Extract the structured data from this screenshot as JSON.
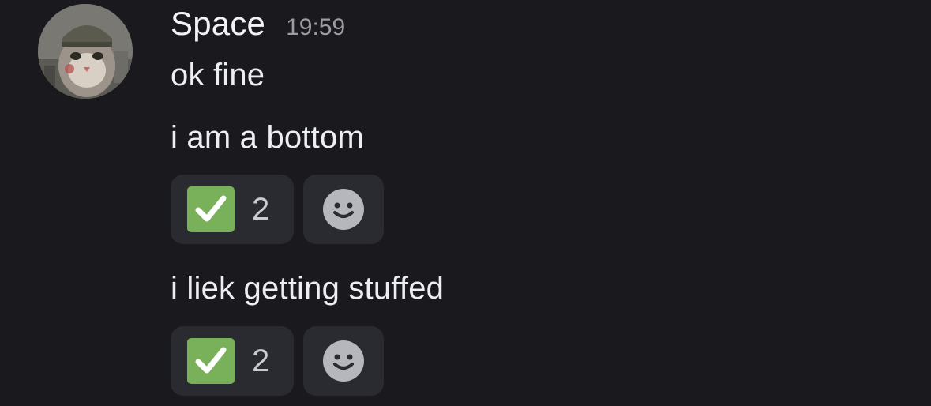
{
  "message": {
    "author": "Space",
    "timestamp": "19:59",
    "avatar_icon": "cat-helmet-avatar",
    "lines": [
      {
        "text": "ok fine",
        "reactions": []
      },
      {
        "text": "i am a bottom",
        "reactions": [
          {
            "emoji": "white-check-mark-icon",
            "count": "2"
          }
        ]
      },
      {
        "text": "i liek getting stuffed",
        "reactions": [
          {
            "emoji": "white-check-mark-icon",
            "count": "2"
          }
        ]
      }
    ]
  },
  "colors": {
    "background": "#1a1a1e",
    "reaction_bg": "#2a2b30",
    "check_green": "#78b159",
    "timestamp": "#9b9ca3"
  }
}
